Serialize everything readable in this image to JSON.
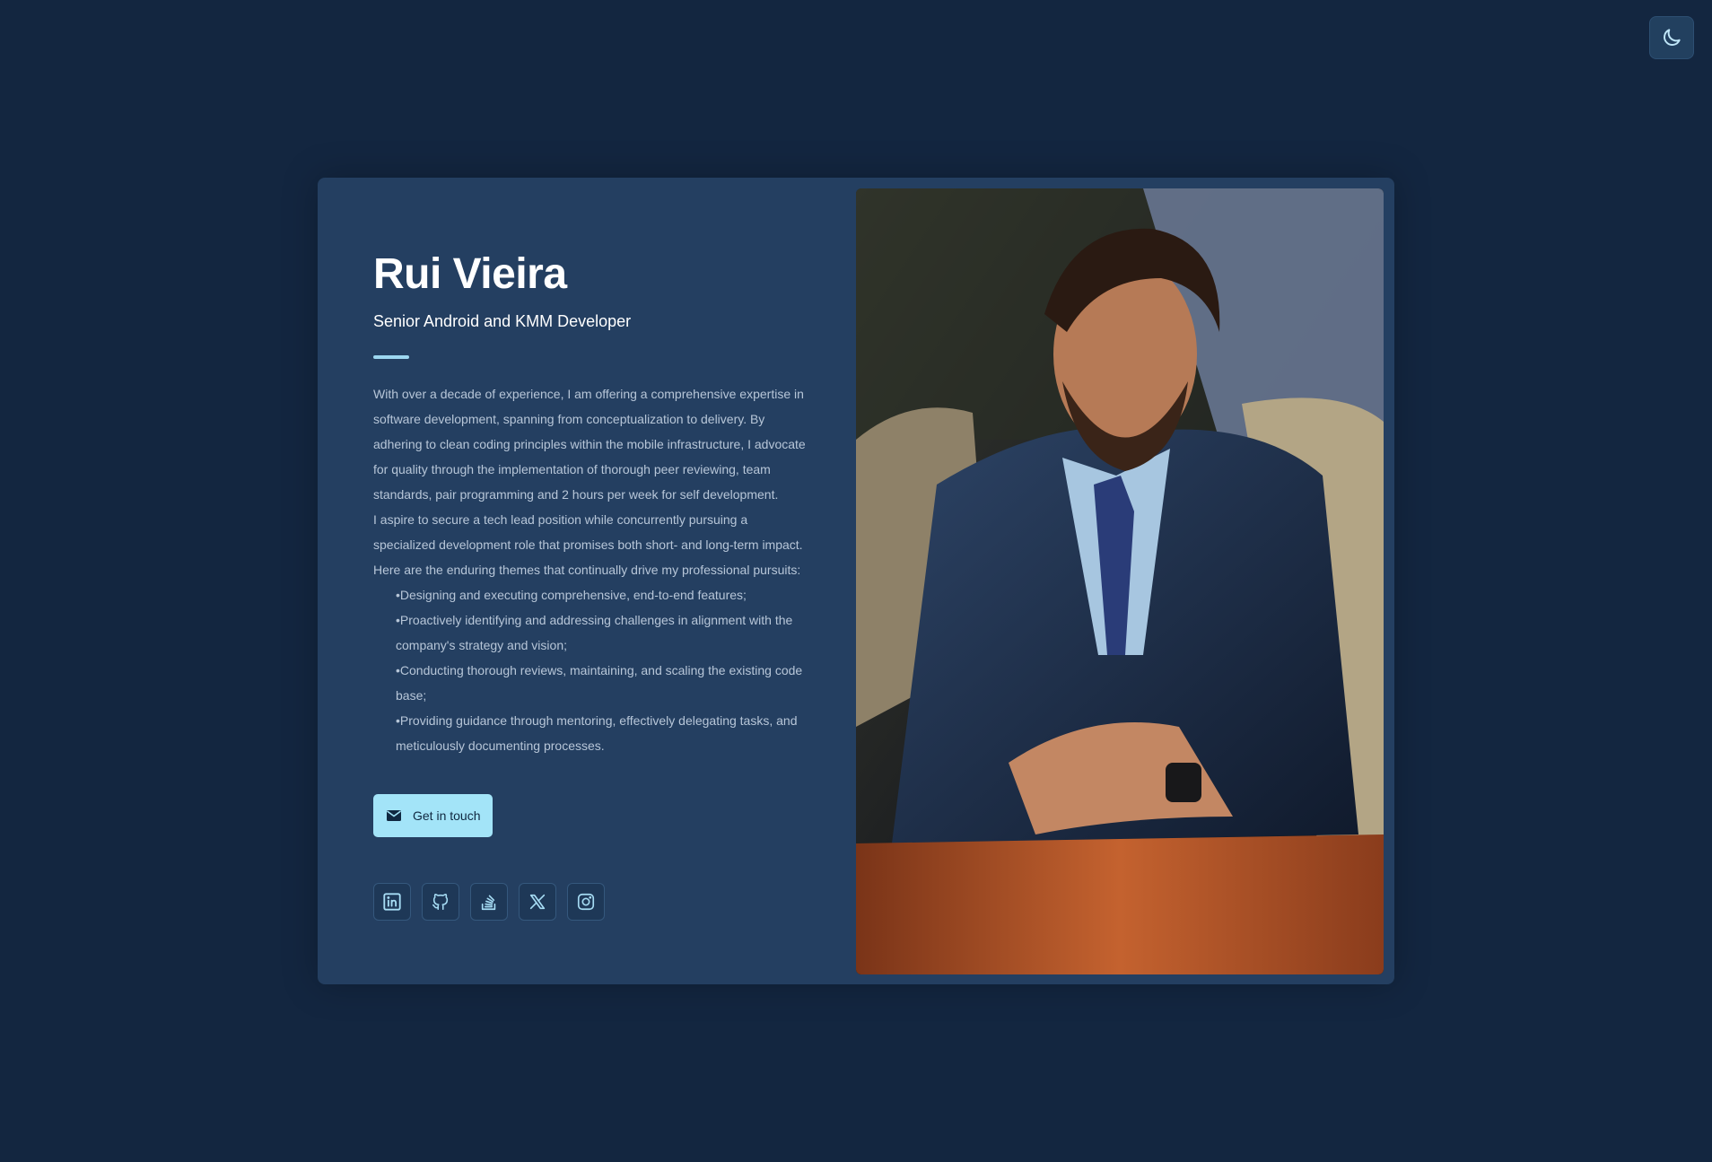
{
  "header": {
    "theme_toggle_icon": "moon-icon"
  },
  "profile": {
    "name": "Rui Vieira",
    "role": "Senior Android and KMM Developer",
    "bio_paragraphs": [
      "With over a decade of experience, I am offering a comprehensive expertise in software development, spanning from conceptualization to delivery. By adhering to clean coding principles within the mobile infrastructure, I advocate for quality through the implementation of thorough peer reviewing, team standards, pair programming and 2 hours per week for self development.",
      "I aspire to secure a tech lead position while concurrently pursuing a specialized development role that promises both short- and long-term impact.",
      "Here are the enduring themes that continually drive my professional pursuits:"
    ],
    "themes": [
      "Designing and executing comprehensive, end-to-end features;",
      "Proactively identifying and addressing challenges in alignment with the company's strategy and vision;",
      "Conducting thorough reviews, maintaining, and scaling the existing code base;",
      "Providing guidance through mentoring, effectively delegating tasks, and meticulously documenting processes."
    ],
    "cta_label": "Get in touch",
    "cta_icon": "mail-icon",
    "socials": [
      {
        "icon": "linkedin-icon"
      },
      {
        "icon": "github-icon"
      },
      {
        "icon": "stack-overflow-icon"
      },
      {
        "icon": "x-icon"
      },
      {
        "icon": "instagram-icon"
      }
    ],
    "photo_icon": "portrait-photo"
  },
  "colors": {
    "page_background": "#132640",
    "card_background": "#243f61",
    "accent": "#9cd7f0",
    "button_background": "#a3e4f8",
    "icon_color": "#a6dcf4"
  }
}
